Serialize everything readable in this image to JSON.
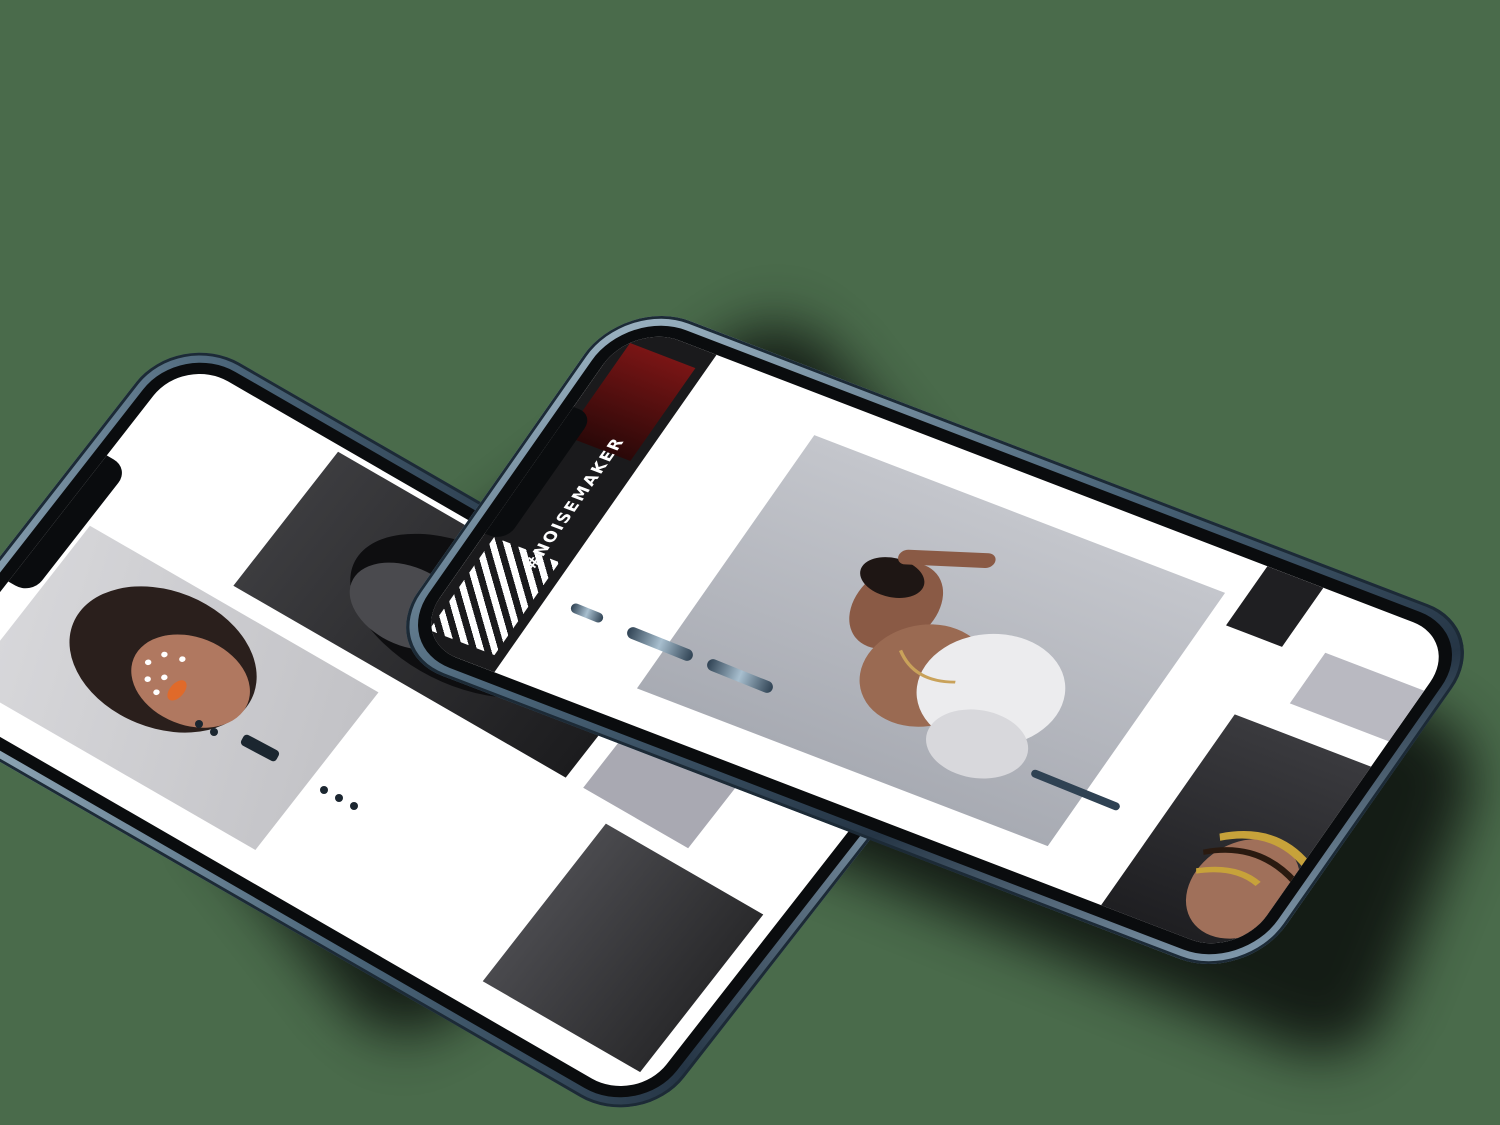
{
  "scene": {
    "background_color": "#4a6b4b",
    "phone_frame_color": "#4a6478"
  },
  "back_phone": {
    "photos": [
      {
        "name": "portrait-pearl-makeup",
        "tone": "#cfcfd2"
      },
      {
        "name": "portrait-dark-garment",
        "tone": "#2a2a2c"
      },
      {
        "name": "portrait-leather-top",
        "tone": "#3a3a3d"
      }
    ]
  },
  "front_phone": {
    "sidebar_text": "#NOISEMAKER",
    "photos": [
      {
        "name": "portrait-white-ruffle-pose",
        "tone": "#b8babf"
      },
      {
        "name": "portrait-gold-braids",
        "tone": "#2d2d30"
      },
      {
        "name": "thumbnail-red-black",
        "tone": "#3a1212"
      }
    ]
  }
}
